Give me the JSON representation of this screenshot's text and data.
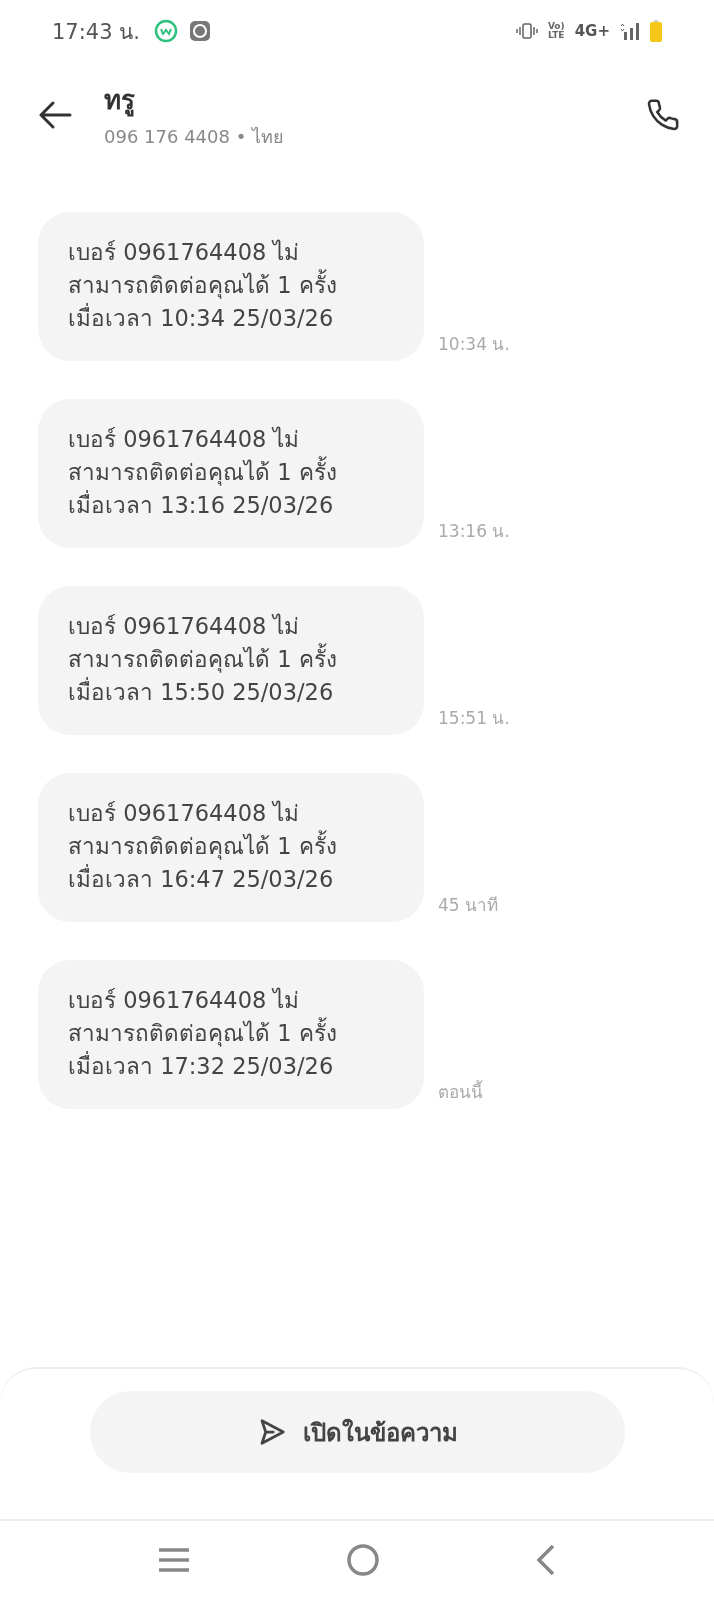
{
  "status_bar": {
    "time": "17:43 น.",
    "volte_top": "Vo)",
    "volte_bottom": "LTE",
    "network": "4G+"
  },
  "header": {
    "name": "ทรู",
    "subtitle": "096 176 4408 • ไทย"
  },
  "messages": [
    {
      "text": "เบอร์ 0961764408 ไม่\nสามารถติดต่อคุณได้ 1 ครั้ง\nเมื่อเวลา 10:34 25/03/26",
      "time": "10:34 น."
    },
    {
      "text": "เบอร์ 0961764408 ไม่\nสามารถติดต่อคุณได้ 1 ครั้ง\nเมื่อเวลา 13:16 25/03/26",
      "time": "13:16 น."
    },
    {
      "text": "เบอร์ 0961764408 ไม่\nสามารถติดต่อคุณได้ 1 ครั้ง\nเมื่อเวลา 15:50 25/03/26",
      "time": "15:51 น."
    },
    {
      "text": "เบอร์ 0961764408 ไม่\nสามารถติดต่อคุณได้ 1 ครั้ง\nเมื่อเวลา 16:47 25/03/26",
      "time": "45 นาที"
    },
    {
      "text": "เบอร์ 0961764408 ไม่\nสามารถติดต่อคุณได้ 1 ครั้ง\nเมื่อเวลา 17:32 25/03/26",
      "time": "ตอนนี้"
    }
  ],
  "open_button": {
    "label": "เปิดในข้อความ"
  }
}
